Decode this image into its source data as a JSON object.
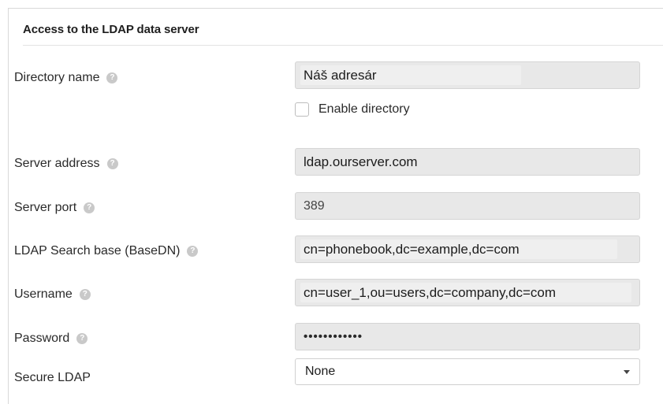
{
  "section": {
    "title": "Access to the LDAP data server"
  },
  "help_icon_glyph": "?",
  "fields": {
    "directory_name": {
      "label": "Directory name",
      "value": "Náš adresár"
    },
    "enable_directory": {
      "label": "Enable directory",
      "checked": false
    },
    "server_address": {
      "label": "Server address",
      "value": "ldap.ourserver.com"
    },
    "server_port": {
      "label": "Server port",
      "value": "389"
    },
    "search_base": {
      "label": "LDAP Search base (BaseDN)",
      "value": "cn=phonebook,dc=example,dc=com"
    },
    "username": {
      "label": "Username",
      "value": "cn=user_1,ou=users,dc=company,dc=com"
    },
    "password": {
      "label": "Password",
      "value": "••••••••••••"
    },
    "secure_ldap": {
      "label": "Secure LDAP",
      "selected": "None"
    }
  },
  "icons": {
    "help": "help-circle-icon",
    "dropdown": "chevron-down-icon"
  },
  "colors": {
    "field_background": "#e8e8e8",
    "help_icon": "#c9c9c9",
    "border": "#d8d8d8"
  }
}
